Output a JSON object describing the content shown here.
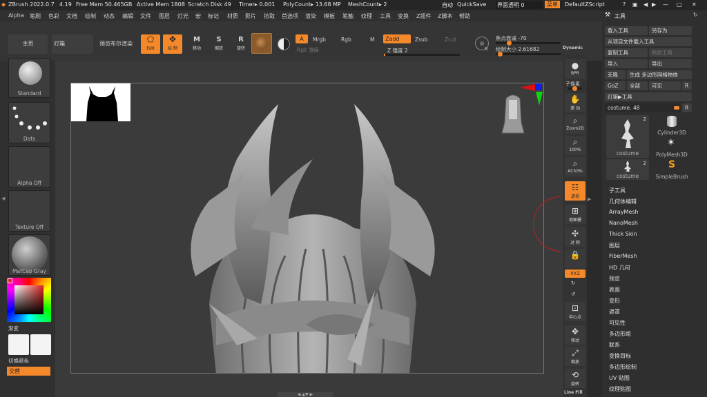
{
  "titlebar": {
    "app": "ZBrush 2022.0.7",
    "version": "4.19",
    "free_mem": "Free Mem 50.465GB",
    "active_mem": "Active Mem 1808",
    "scratch": "Scratch Disk 49",
    "timer": "Timer▸ 0.001",
    "polycount": "PolyCount▸ 13.68 MP",
    "meshcount": "MeshCount▸ 2",
    "auto": "自动",
    "quicksave": "QuickSave",
    "transparency": "界面透明 0",
    "menu": "菜单",
    "script": "DefaultZScript"
  },
  "menubar": [
    "Alpha",
    "笔刷",
    "色彩",
    "文档",
    "绘制",
    "动态",
    "编辑",
    "文件",
    "图层",
    "灯光",
    "宏",
    "标记",
    "材质",
    "影片",
    "拾取",
    "首选项",
    "渲染",
    "模板",
    "笔触",
    "纹理",
    "工具",
    "变换",
    "Z插件",
    "Z脚本",
    "帮助"
  ],
  "toolbar": {
    "home": "主页",
    "lightbox": "灯箱",
    "bpr": "预览布尔渲染",
    "edit": "Edit",
    "draw": "绘 制",
    "move": "移动",
    "scale": "缩放",
    "rotate": "旋转",
    "a": "A",
    "mrgb": "Mrgb",
    "rgb": "Rgb",
    "m": "M",
    "zadd": "Zadd",
    "zsub": "Zsub",
    "zcut": "Zcut",
    "rgb_intensity": "Rgb 强度",
    "z_intensity": "Z 强度 2",
    "z_intensity_value": 2,
    "focal": "焦点衰减 -70",
    "draw_size": "绘制大小 2.61682",
    "dynamic": "Dynamic"
  },
  "leftpanel": {
    "brush": "Standard",
    "stroke": "Dots",
    "alpha": "Alpha Off",
    "texture": "Texture Off",
    "material": "MatCap Gray",
    "gradient": "渐变",
    "switch": "切换颜色",
    "alternate": "交替"
  },
  "righttools": {
    "bpr": "BPR",
    "subpixel": "子像素",
    "scroll": "滚 动",
    "zoom2d": "Zoom2D",
    "p100": "100%",
    "ac50": "AC50%",
    "perspective": "透视",
    "floor": "地面栅",
    "local": "对 称",
    "lock": "锁",
    "xyz": "XYZ",
    "frame": "中心点",
    "move": "移动",
    "scale": "缩放",
    "rotate": "旋转",
    "linefill": "Line Fill"
  },
  "toolpanel": {
    "title": "工具",
    "load": "载入工具",
    "saveas": "另存为",
    "load_project": "从项目文件载入工具",
    "copy": "复制工具",
    "paste": "粘贴工具",
    "import": "导入",
    "export": "导出",
    "clone": "克隆",
    "make_polymesh": "生成 多边形网格物体",
    "goz": "GoZ",
    "all": "全部",
    "visible": "可见",
    "r": "R",
    "lightbox_tools": "灯箱▶工具",
    "current": "costume. 48",
    "thumbs": [
      {
        "label": "costume",
        "count": "2"
      },
      {
        "label": "Cylinder3D",
        "count": ""
      },
      {
        "label": "PolyMesh3D",
        "count": ""
      },
      {
        "label": "costume",
        "count": "2"
      },
      {
        "label": "SimpleBrush",
        "count": ""
      }
    ],
    "subpalettes": [
      "子工具",
      "几何体编辑",
      "ArrayMesh",
      "NanoMesh",
      "Thick Skin",
      "图层",
      "FiberMesh",
      "HD 几何",
      "预览",
      "表面",
      "变形",
      "遮罩",
      "可见性",
      "多边形组",
      "联系",
      "变换目标",
      "多边形绘制",
      "UV 贴图",
      "纹理贴图"
    ]
  }
}
